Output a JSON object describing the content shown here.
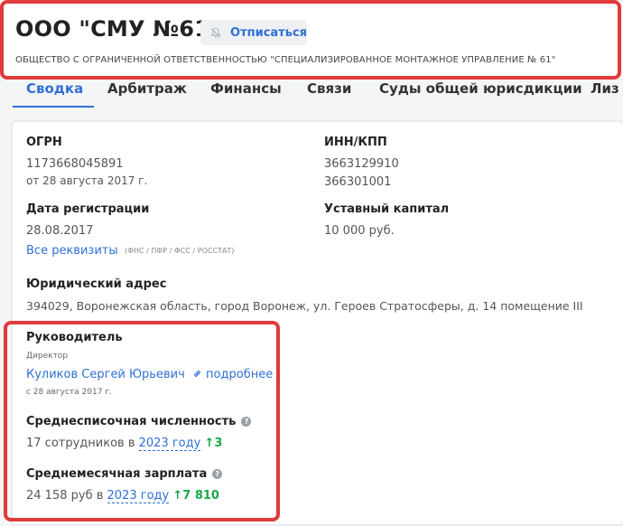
{
  "company": {
    "short_name": "ООО \"СМУ №61\"",
    "full_name": "ОБЩЕСТВО С ОГРАНИЧЕННОЙ ОТВЕТСТВЕННОСТЬЮ \"СПЕЦИАЛИЗИРОВАННОЕ МОНТАЖНОЕ УПРАВЛЕНИЕ № 61\"",
    "unsubscribe_label": "Отписаться",
    "unsubscribe_icon": "bell-off-icon"
  },
  "tabs": [
    "Сводка",
    "Арбитраж",
    "Финансы",
    "Связи",
    "Суды общей юрисдикции",
    "Лиз"
  ],
  "summary": {
    "ogrn_label": "ОГРН",
    "ogrn_value": "1173668045891",
    "ogrn_date": "от 28 августа 2017 г.",
    "inn_label": "ИНН/КПП",
    "inn_value": "3663129910",
    "kpp_value": "366301001",
    "reg_label": "Дата регистрации",
    "reg_value": "28.08.2017",
    "all_requisites_link": "Все реквизиты",
    "requisites_note": "(ФНС / ПФР / ФСС / РОССТАТ)",
    "capital_label": "Уставный капитал",
    "capital_value": "10 000 руб.",
    "address_label": "Юридический адрес",
    "address_value": "394029, Воронежская область, город Воронеж, ул. Героев Стратосферы, д. 14 помещение III",
    "manager_label": "Руководитель",
    "manager_role": "Директор",
    "manager_name": "Куликов Сергей Юрьевич",
    "manager_more": "подробнее",
    "manager_since": "с 28 августа 2017 г.",
    "headcount_label": "Среднесписочная численность",
    "headcount_text": "17 сотрудников в",
    "headcount_year": "2023 году",
    "headcount_delta": "3",
    "salary_label": "Среднемесячная зарплата",
    "salary_text": "24 158 руб в",
    "salary_year": "2023 году",
    "salary_delta": "7 810"
  },
  "colors": {
    "accent": "#2f6fd6",
    "highlight": "#e03a3a",
    "positive": "#1aa84a"
  }
}
